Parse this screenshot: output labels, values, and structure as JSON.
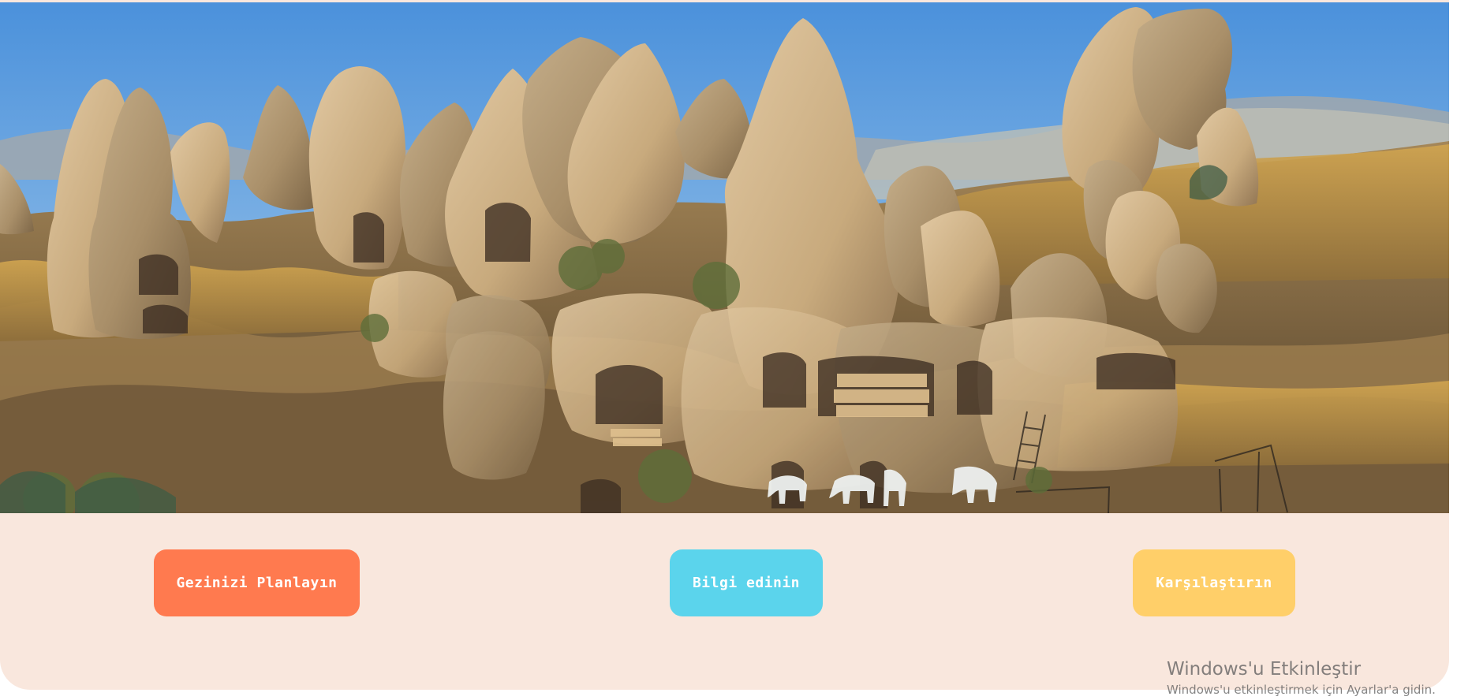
{
  "hero": {
    "image_icon": "cappadocia-fairy-chimneys-image"
  },
  "actions": {
    "plan": "Gezinizi Planlayın",
    "info": "Bilgi edinin",
    "compare": "Karşılaştırın"
  },
  "colors": {
    "background": "#f9e7dd",
    "plan": "#ff7a4f",
    "info": "#5bd4ec",
    "compare": "#ffcf69",
    "button_text": "#ffffff"
  },
  "watermark": {
    "title": "Windows'u Etkinleştir",
    "subtitle": "Windows'u etkinleştirmek için Ayarlar'a gidin."
  },
  "scrollbar": {
    "arrow_icon": "scroll-up-icon"
  }
}
